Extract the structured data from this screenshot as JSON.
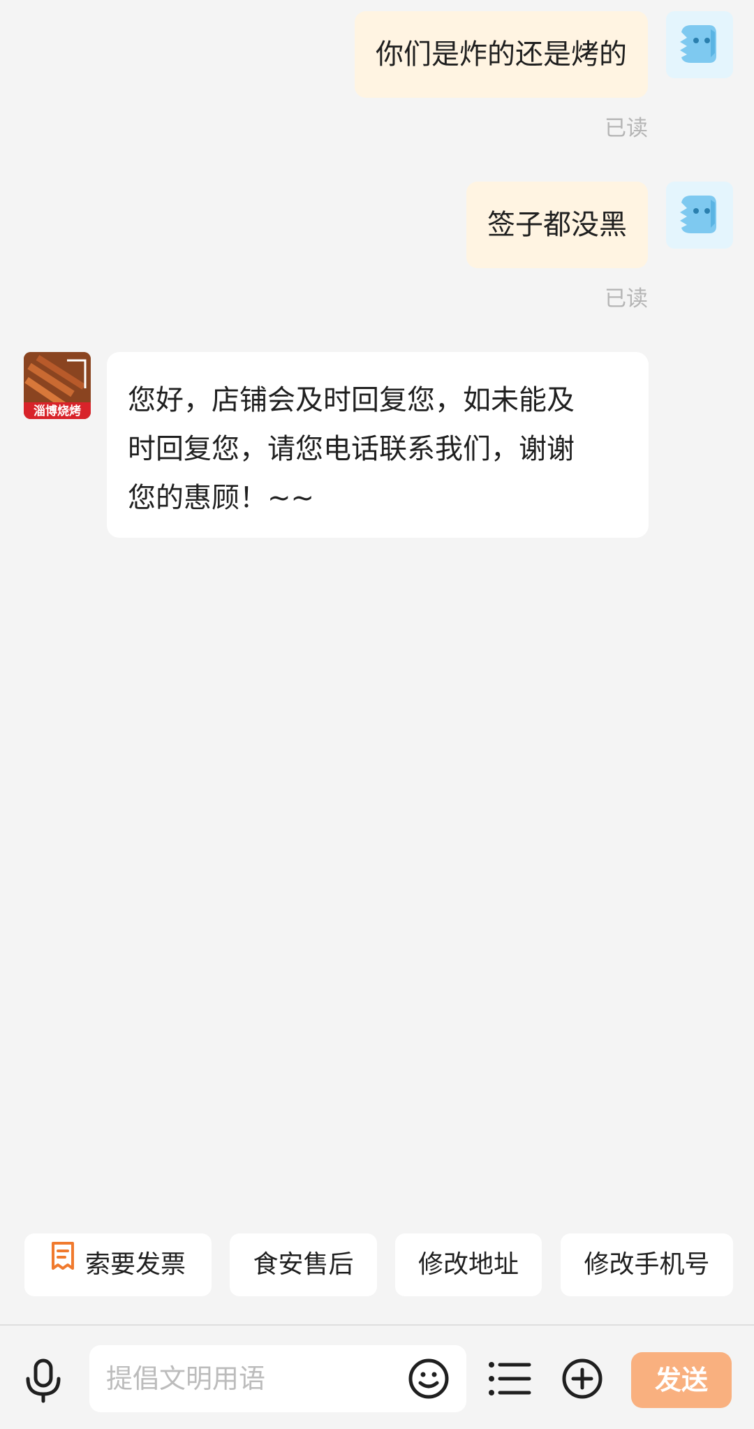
{
  "messages": [
    {
      "direction": "outgoing",
      "text": "你们是炸的还是烤的",
      "status": "已读"
    },
    {
      "direction": "outgoing",
      "text": "签子都没黑",
      "status": "已读"
    },
    {
      "direction": "incoming",
      "text_lines": [
        "您好，店铺会及时回复您，如未能及",
        "时回复您，请您电话联系我们，谢谢",
        "您的惠顾！~~"
      ]
    }
  ],
  "shop_avatar": {
    "logo_text": "淄博烧烤"
  },
  "quick_replies": [
    {
      "label": "索要发票",
      "icon": "receipt-icon"
    },
    {
      "label": "食安售后"
    },
    {
      "label": "修改地址"
    },
    {
      "label": "修改手机号"
    }
  ],
  "input": {
    "placeholder": "提倡文明用语"
  },
  "send_label": "发送",
  "icons": [
    "microphone-icon",
    "emoji-icon",
    "list-icon",
    "plus-circle-icon"
  ],
  "colors": {
    "outgoing_bubble": "#fff4e2",
    "send_button": "#f9b07f",
    "receipt_icon": "#f07a2e",
    "avatar_bg": "#e4f5fd"
  }
}
